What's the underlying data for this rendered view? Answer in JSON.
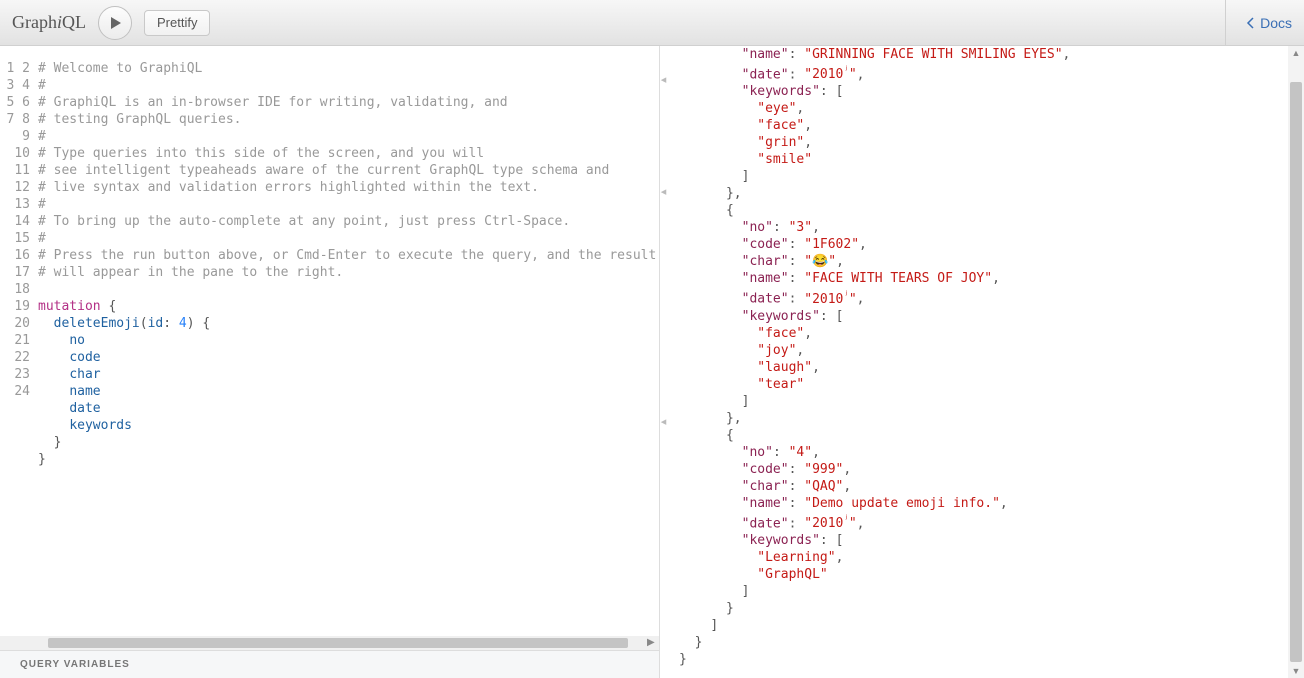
{
  "app_name": "GraphiQL",
  "toolbar": {
    "prettify_label": "Prettify",
    "docs_label": "Docs"
  },
  "query_variables_label": "Query Variables",
  "editor": {
    "line_numbers": [
      "1",
      "2",
      "3",
      "4",
      "5",
      "6",
      "7",
      "8",
      "9",
      "10",
      "11",
      "12",
      "13",
      "14",
      "15",
      "16",
      "17",
      "18",
      "19",
      "20",
      "21",
      "22",
      "23",
      "24"
    ],
    "lines": [
      {
        "t": "comment",
        "text": "# Welcome to GraphiQL"
      },
      {
        "t": "comment",
        "text": "#"
      },
      {
        "t": "comment",
        "text": "# GraphiQL is an in-browser IDE for writing, validating, and"
      },
      {
        "t": "comment",
        "text": "# testing GraphQL queries."
      },
      {
        "t": "comment",
        "text": "#"
      },
      {
        "t": "comment",
        "text": "# Type queries into this side of the screen, and you will"
      },
      {
        "t": "comment",
        "text": "# see intelligent typeaheads aware of the current GraphQL type schema and"
      },
      {
        "t": "comment",
        "text": "# live syntax and validation errors highlighted within the text."
      },
      {
        "t": "comment",
        "text": "#"
      },
      {
        "t": "comment",
        "text": "# To bring up the auto-complete at any point, just press Ctrl-Space."
      },
      {
        "t": "comment",
        "text": "#"
      },
      {
        "t": "comment",
        "text": "# Press the run button above, or Cmd-Enter to execute the query, and the result"
      },
      {
        "t": "comment",
        "text": "# will appear in the pane to the right."
      },
      {
        "t": "blank",
        "text": ""
      },
      {
        "t": "mutation_open",
        "fold": true,
        "keyword": "mutation",
        "text": " {"
      },
      {
        "t": "call_open",
        "fold": true,
        "indent": "  ",
        "fn": "deleteEmoji",
        "arg_key": "id",
        "arg_val": "4",
        "tail": ") {"
      },
      {
        "t": "field",
        "indent": "    ",
        "text": "no"
      },
      {
        "t": "field",
        "indent": "    ",
        "text": "code"
      },
      {
        "t": "field",
        "indent": "    ",
        "text": "char"
      },
      {
        "t": "field",
        "indent": "    ",
        "text": "name"
      },
      {
        "t": "field",
        "indent": "    ",
        "text": "date"
      },
      {
        "t": "field",
        "indent": "    ",
        "text": "keywords"
      },
      {
        "t": "close",
        "indent": "  ",
        "text": "}"
      },
      {
        "t": "close",
        "indent": "",
        "text": "}"
      }
    ]
  },
  "result_lines": [
    {
      "i": 4,
      "k": "name",
      "v": "GRINNING FACE WITH SMILING EYES",
      "c": true
    },
    {
      "i": 4,
      "k": "date",
      "v": "2010",
      "sup": "ʲ",
      "c": true
    },
    {
      "i": 4,
      "k": "keywords",
      "open": "["
    },
    {
      "i": 5,
      "v": "eye",
      "c": true
    },
    {
      "i": 5,
      "v": "face",
      "c": true
    },
    {
      "i": 5,
      "v": "grin",
      "c": true
    },
    {
      "i": 5,
      "v": "smile"
    },
    {
      "i": 4,
      "close": "]"
    },
    {
      "i": 3,
      "close": "},"
    },
    {
      "i": 3,
      "open": "{"
    },
    {
      "i": 4,
      "k": "no",
      "v": "3",
      "c": true
    },
    {
      "i": 4,
      "k": "code",
      "v": "1F602",
      "c": true
    },
    {
      "i": 4,
      "k": "char",
      "v": "😂",
      "c": true
    },
    {
      "i": 4,
      "k": "name",
      "v": "FACE WITH TEARS OF JOY",
      "c": true
    },
    {
      "i": 4,
      "k": "date",
      "v": "2010",
      "sup": "ʲ",
      "c": true
    },
    {
      "i": 4,
      "k": "keywords",
      "open": "["
    },
    {
      "i": 5,
      "v": "face",
      "c": true
    },
    {
      "i": 5,
      "v": "joy",
      "c": true
    },
    {
      "i": 5,
      "v": "laugh",
      "c": true
    },
    {
      "i": 5,
      "v": "tear"
    },
    {
      "i": 4,
      "close": "]"
    },
    {
      "i": 3,
      "close": "},"
    },
    {
      "i": 3,
      "open": "{"
    },
    {
      "i": 4,
      "k": "no",
      "v": "4",
      "c": true
    },
    {
      "i": 4,
      "k": "code",
      "v": "999",
      "c": true
    },
    {
      "i": 4,
      "k": "char",
      "v": "QAQ",
      "c": true
    },
    {
      "i": 4,
      "k": "name",
      "v": "Demo update emoji info.",
      "c": true
    },
    {
      "i": 4,
      "k": "date",
      "v": "2010",
      "sup": "ʲ",
      "c": true
    },
    {
      "i": 4,
      "k": "keywords",
      "open": "["
    },
    {
      "i": 5,
      "v": "Learning",
      "c": true
    },
    {
      "i": 5,
      "v": "GraphQL"
    },
    {
      "i": 4,
      "close": "]"
    },
    {
      "i": 3,
      "close": "}"
    },
    {
      "i": 2,
      "close": "]"
    },
    {
      "i": 1,
      "close": "}"
    },
    {
      "i": 0,
      "close": "}"
    }
  ]
}
